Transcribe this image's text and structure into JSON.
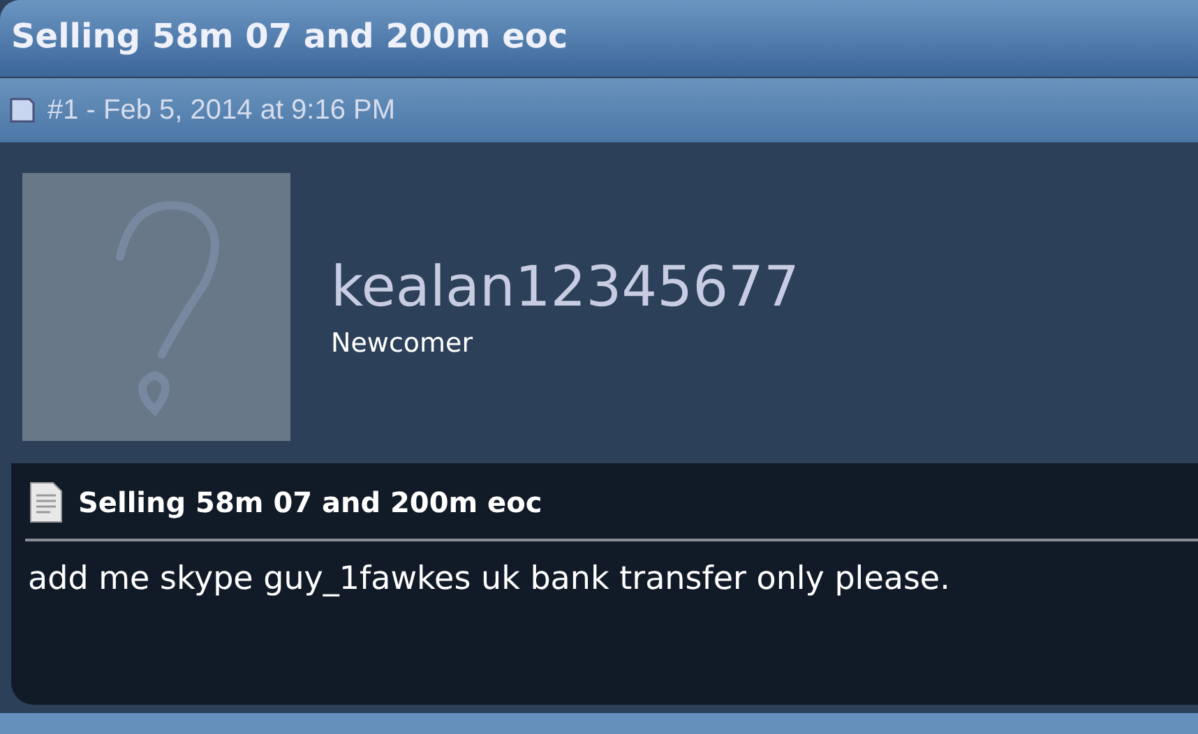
{
  "thread": {
    "title": "Selling 58m 07 and 200m eoc"
  },
  "post": {
    "header": "#1 - Feb 5, 2014 at 9:16 PM",
    "author": {
      "username": "kealan12345677",
      "rank": "Newcomer"
    },
    "title": "Selling 58m 07 and 200m eoc",
    "message": "add me skype guy_1fawkes uk bank transfer only please."
  }
}
